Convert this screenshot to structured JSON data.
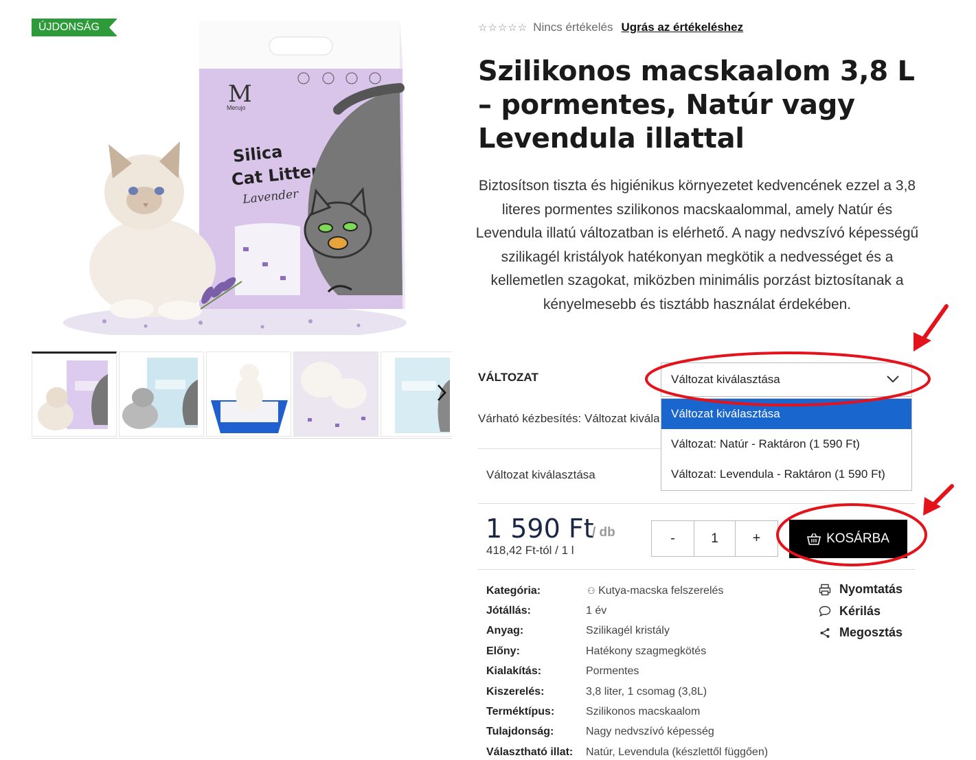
{
  "badge": {
    "label": "ÚJDONSÁG",
    "color": "#2e9b3b"
  },
  "gallery": {
    "main_alt": "Merujo Silica Cat Litter Lavender",
    "package": {
      "brand": "Merujo",
      "line1": "Silica",
      "line2": "Cat Litter",
      "variant": "Lavender"
    },
    "thumbnails": [
      "thumb-lavender-bag-cat",
      "thumb-blue-bag-cat",
      "thumb-cat-in-litter-box",
      "thumb-cat-paws-litter",
      "thumb-blue-bag"
    ],
    "next_icon": "chevron-right-icon"
  },
  "rating": {
    "stars_icon": "☆☆☆☆☆",
    "no_rating_text": "Nincs értékelés",
    "link_text": "Ugrás az értékeléshez"
  },
  "product": {
    "title": "Szilikonos macskaalom 3,8 L – pormentes, Natúr vagy Levendula illattal",
    "description": "Biztosítson tiszta és higiénikus környezetet kedvencének ezzel a 3,8 literes pormentes szilikonos macskaalommal, amely Natúr és Levendula illatú változatban is elérhető. A nagy nedvszívó képességű szilikagél kristályok hatékonyan megkötik a nedvességet és a kellemetlen szagokat, miközben minimális porzást biztosítanak a kényelmesebb és tisztább használat érdekében."
  },
  "variant": {
    "label": "VÁLTOZAT",
    "selected": "Változat kiválasztása",
    "options": [
      "Változat kiválasztása",
      "Változat: Natúr - Raktáron  (1 590 Ft)",
      "Változat: Levendula - Raktáron  (1 590 Ft)"
    ],
    "delivery_text": "Várható kézbesítés: Változat kiválasztása",
    "status_text": "Változat kiválasztása"
  },
  "price": {
    "value": "1 590 Ft",
    "per_unit": "/ db",
    "unit_price": "418,42 Ft-tól / 1 l"
  },
  "quantity": {
    "minus": "-",
    "value": "1",
    "plus": "+"
  },
  "cart": {
    "label": "KOSÁRBA",
    "icon": "basket-icon"
  },
  "properties": [
    {
      "key": "Kategória:",
      "value": "Kutya-macska felszerelés",
      "icon": "paw-icon"
    },
    {
      "key": "Jótállás:",
      "value": "1 év"
    },
    {
      "key": "Anyag:",
      "value": "Szilikagél kristály"
    },
    {
      "key": "Előny:",
      "value": "Hatékony szagmegkötés"
    },
    {
      "key": "Kialakítás:",
      "value": "Pormentes"
    },
    {
      "key": "Kiszerelés:",
      "value": "3,8 liter, 1 csomag (3,8L)"
    },
    {
      "key": "Terméktípus:",
      "value": "Szilikonos macskaalom"
    },
    {
      "key": "Tulajdonság:",
      "value": "Nagy nedvszívó képesség"
    },
    {
      "key": "Választható illat:",
      "value": "Natúr, Levendula (készlettől függően)"
    }
  ],
  "actions": [
    {
      "label": "Nyomtatás",
      "icon": "printer-icon"
    },
    {
      "label": "Kérilás",
      "icon": "chat-bubble-icon"
    },
    {
      "label": "Megosztás",
      "icon": "share-icon"
    }
  ],
  "colors": {
    "annotation_red": "#e4131b",
    "dropdown_selected": "#1a66cf",
    "price": "#1a2744"
  }
}
